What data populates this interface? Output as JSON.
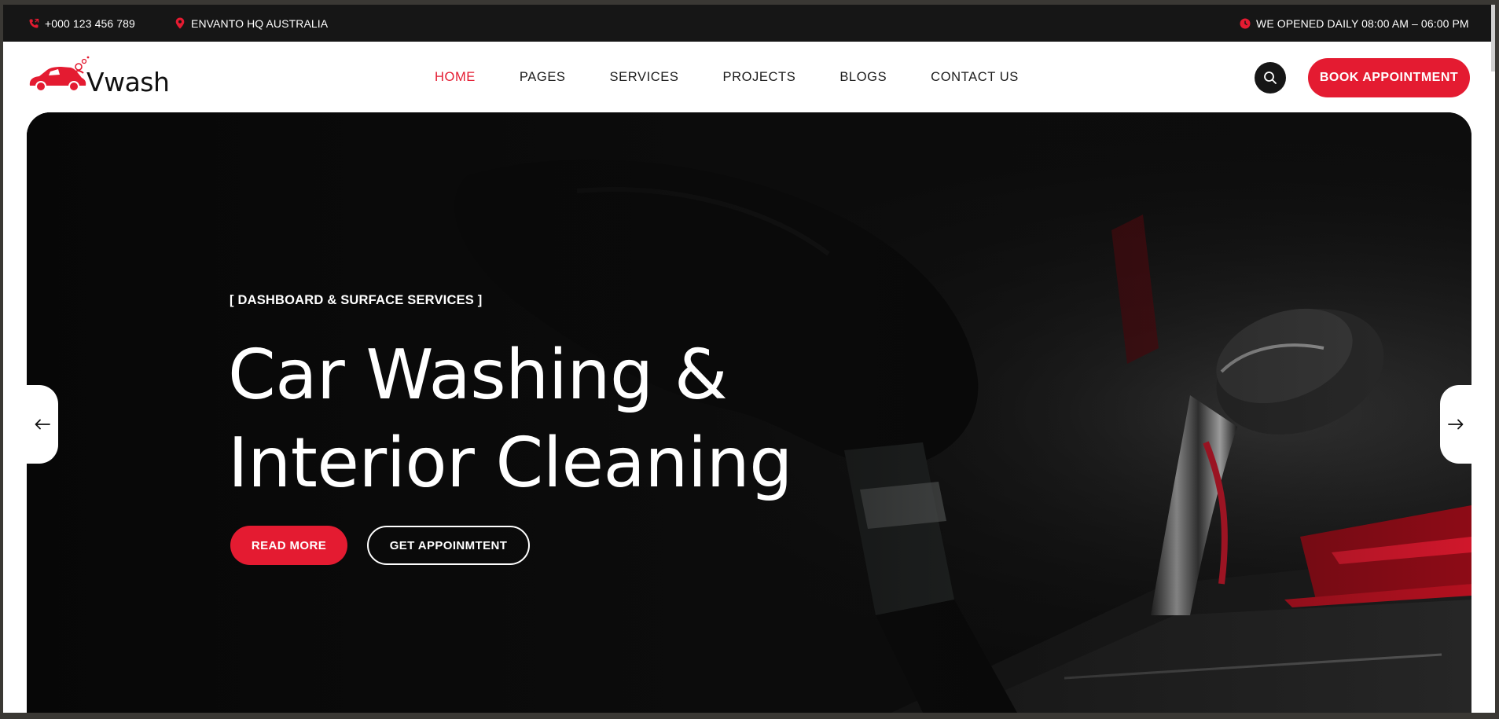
{
  "topbar": {
    "phone": "+000 123 456 789",
    "location": "ENVANTO HQ AUSTRALIA",
    "hours": "WE OPENED DAILY 08:00 AM – 06:00 PM",
    "phone_icon": "phone-icon",
    "location_icon": "map-pin-icon",
    "hours_icon": "clock-icon"
  },
  "header": {
    "logo_text": "Vwash",
    "nav": [
      {
        "label": "HOME",
        "active": true
      },
      {
        "label": "PAGES",
        "active": false
      },
      {
        "label": "SERVICES",
        "active": false
      },
      {
        "label": "PROJECTS",
        "active": false
      },
      {
        "label": "BLOGS",
        "active": false
      },
      {
        "label": "CONTACT US",
        "active": false
      }
    ],
    "search_icon": "search-icon",
    "book_label": "BOOK APPOINTMENT"
  },
  "hero": {
    "eyebrow": "[ DASHBOARD & SURFACE SERVICES ]",
    "title_line1": "Car Washing &",
    "title_line2": "Interior Cleaning",
    "read_more": "READ MORE",
    "get_appointment": "GET APPOINMTENT",
    "prev_icon": "arrow-left-icon",
    "next_icon": "arrow-right-icon"
  },
  "colors": {
    "accent": "#e41b31",
    "topbar_bg": "#161616",
    "hero_bg": "#0b0b0b"
  }
}
